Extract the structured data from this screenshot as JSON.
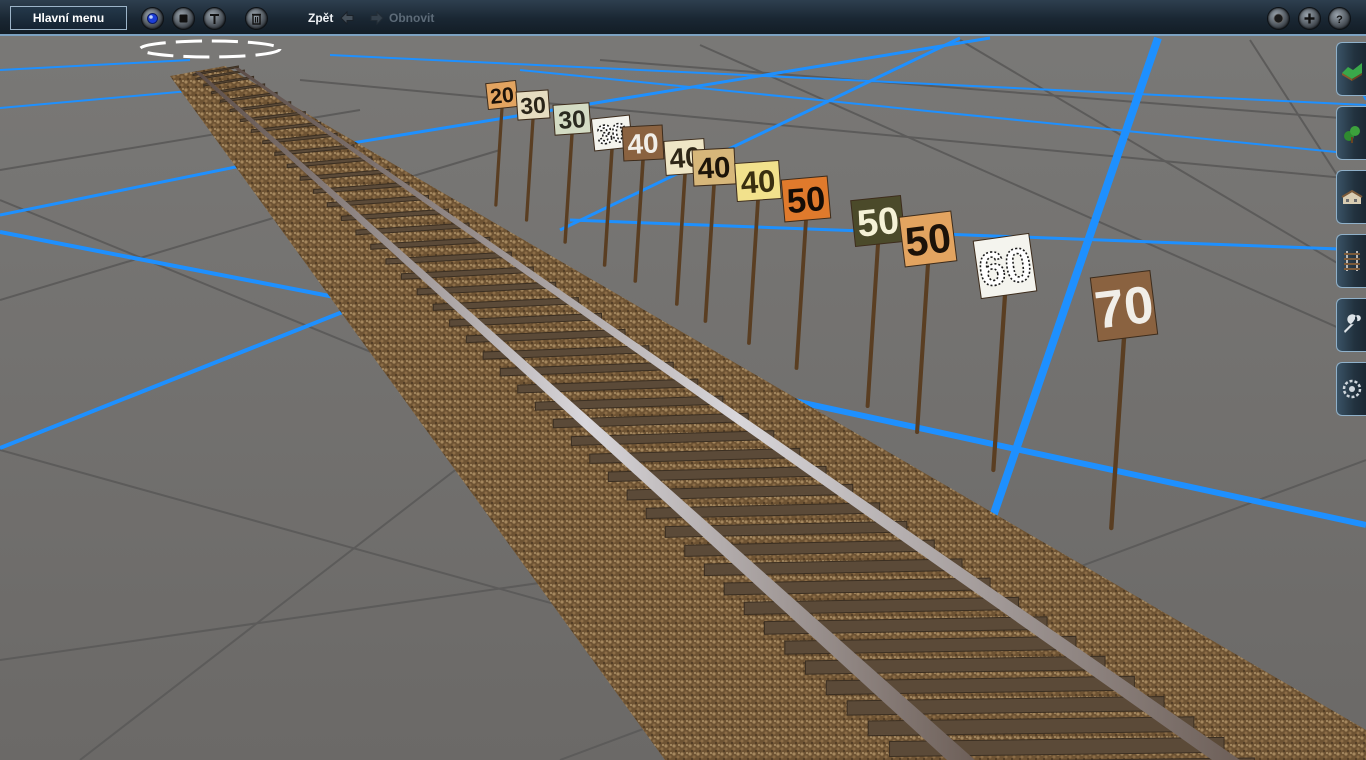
{
  "toolbar": {
    "main_menu_label": "Hlavní menu",
    "undo_label": "Zpět",
    "redo_label": "Obnovit",
    "left_icons": [
      "globe-icon",
      "stop-icon",
      "tool-icon",
      "trash-icon"
    ],
    "right_icons": [
      "camera-icon",
      "add-icon",
      "help-icon"
    ]
  },
  "side_panel": {
    "tabs": [
      "terrain-tab",
      "trees-tab",
      "buildings-tab",
      "track-tab",
      "tools-tab",
      "settings-tab"
    ]
  },
  "scene": {
    "grid_line_color": "#1e90ff",
    "ground_color": "#6f6d6b",
    "speed_signs": [
      {
        "value": "20",
        "style": "orange"
      },
      {
        "value": "30",
        "style": "pale"
      },
      {
        "value": "30",
        "style": "pale-green"
      },
      {
        "value": "30",
        "style": "white-dots"
      },
      {
        "value": "40",
        "style": "rusty"
      },
      {
        "value": "40",
        "style": "cream"
      },
      {
        "value": "40",
        "style": "tan"
      },
      {
        "value": "40",
        "style": "yellow"
      },
      {
        "value": "50",
        "style": "rusty-orange"
      },
      {
        "value": "50",
        "style": "dark-olive"
      },
      {
        "value": "50",
        "style": "orange"
      },
      {
        "value": "60",
        "style": "white-dots"
      },
      {
        "value": "70",
        "style": "rusty"
      }
    ]
  }
}
